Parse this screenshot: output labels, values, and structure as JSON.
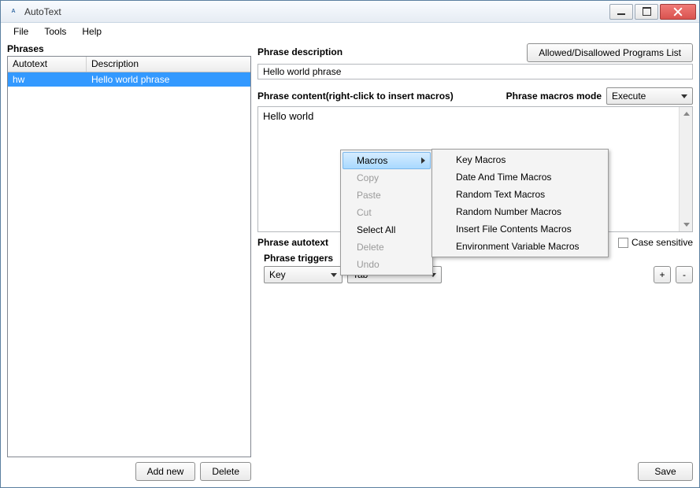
{
  "window": {
    "title": "AutoText",
    "icon_label": "ABC"
  },
  "menu": {
    "file": "File",
    "tools": "Tools",
    "help": "Help"
  },
  "left": {
    "section": "Phrases",
    "col_autotext": "Autotext",
    "col_description": "Description",
    "rows": [
      {
        "autotext": "hw",
        "description": "Hello world phrase"
      }
    ],
    "add_new": "Add new",
    "delete": "Delete"
  },
  "right": {
    "allowed_btn": "Allowed/Disallowed Programs List",
    "desc_label": "Phrase description",
    "desc_value": "Hello world phrase",
    "content_label": "Phrase content(right-click to insert macros)",
    "macros_mode_label": "Phrase macros mode",
    "macros_mode_value": "Execute",
    "content_value": "Hello world",
    "autotext_label": "Phrase autotext",
    "case_sensitive": "Case sensitive",
    "triggers_label": "Phrase triggers",
    "trigger_type": "Key",
    "trigger_value": "Tab",
    "plus": "+",
    "minus": "-",
    "save": "Save"
  },
  "context_menu": {
    "macros": "Macros",
    "copy": "Copy",
    "paste": "Paste",
    "cut": "Cut",
    "select_all": "Select All",
    "delete": "Delete",
    "undo": "Undo"
  },
  "submenu": {
    "key": "Key Macros",
    "datetime": "Date And Time Macros",
    "random_text": "Random Text Macros",
    "random_number": "Random Number Macros",
    "insert_file": "Insert File Contents Macros",
    "env": "Environment Variable Macros"
  }
}
